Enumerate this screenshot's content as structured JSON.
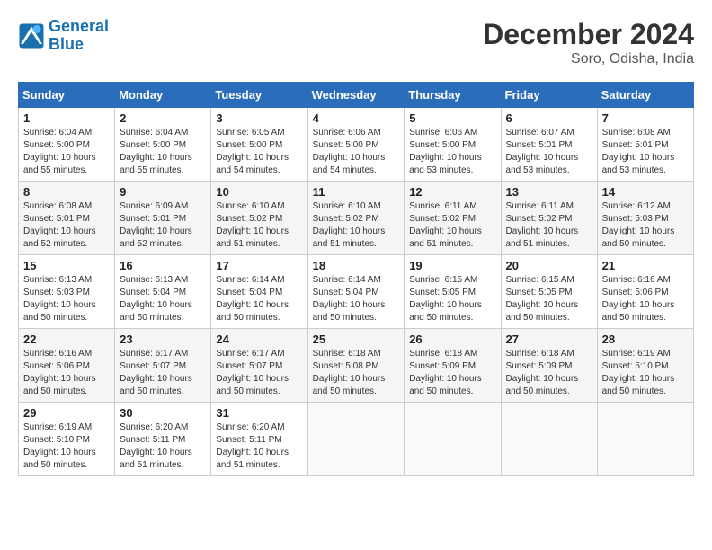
{
  "logo": {
    "line1": "General",
    "line2": "Blue"
  },
  "title": "December 2024",
  "subtitle": "Soro, Odisha, India",
  "weekdays": [
    "Sunday",
    "Monday",
    "Tuesday",
    "Wednesday",
    "Thursday",
    "Friday",
    "Saturday"
  ],
  "weeks": [
    [
      {
        "day": "1",
        "sunrise": "6:04 AM",
        "sunset": "5:00 PM",
        "daylight": "10 hours and 55 minutes."
      },
      {
        "day": "2",
        "sunrise": "6:04 AM",
        "sunset": "5:00 PM",
        "daylight": "10 hours and 55 minutes."
      },
      {
        "day": "3",
        "sunrise": "6:05 AM",
        "sunset": "5:00 PM",
        "daylight": "10 hours and 54 minutes."
      },
      {
        "day": "4",
        "sunrise": "6:06 AM",
        "sunset": "5:00 PM",
        "daylight": "10 hours and 54 minutes."
      },
      {
        "day": "5",
        "sunrise": "6:06 AM",
        "sunset": "5:00 PM",
        "daylight": "10 hours and 53 minutes."
      },
      {
        "day": "6",
        "sunrise": "6:07 AM",
        "sunset": "5:01 PM",
        "daylight": "10 hours and 53 minutes."
      },
      {
        "day": "7",
        "sunrise": "6:08 AM",
        "sunset": "5:01 PM",
        "daylight": "10 hours and 53 minutes."
      }
    ],
    [
      {
        "day": "8",
        "sunrise": "6:08 AM",
        "sunset": "5:01 PM",
        "daylight": "10 hours and 52 minutes."
      },
      {
        "day": "9",
        "sunrise": "6:09 AM",
        "sunset": "5:01 PM",
        "daylight": "10 hours and 52 minutes."
      },
      {
        "day": "10",
        "sunrise": "6:10 AM",
        "sunset": "5:02 PM",
        "daylight": "10 hours and 51 minutes."
      },
      {
        "day": "11",
        "sunrise": "6:10 AM",
        "sunset": "5:02 PM",
        "daylight": "10 hours and 51 minutes."
      },
      {
        "day": "12",
        "sunrise": "6:11 AM",
        "sunset": "5:02 PM",
        "daylight": "10 hours and 51 minutes."
      },
      {
        "day": "13",
        "sunrise": "6:11 AM",
        "sunset": "5:02 PM",
        "daylight": "10 hours and 51 minutes."
      },
      {
        "day": "14",
        "sunrise": "6:12 AM",
        "sunset": "5:03 PM",
        "daylight": "10 hours and 50 minutes."
      }
    ],
    [
      {
        "day": "15",
        "sunrise": "6:13 AM",
        "sunset": "5:03 PM",
        "daylight": "10 hours and 50 minutes."
      },
      {
        "day": "16",
        "sunrise": "6:13 AM",
        "sunset": "5:04 PM",
        "daylight": "10 hours and 50 minutes."
      },
      {
        "day": "17",
        "sunrise": "6:14 AM",
        "sunset": "5:04 PM",
        "daylight": "10 hours and 50 minutes."
      },
      {
        "day": "18",
        "sunrise": "6:14 AM",
        "sunset": "5:04 PM",
        "daylight": "10 hours and 50 minutes."
      },
      {
        "day": "19",
        "sunrise": "6:15 AM",
        "sunset": "5:05 PM",
        "daylight": "10 hours and 50 minutes."
      },
      {
        "day": "20",
        "sunrise": "6:15 AM",
        "sunset": "5:05 PM",
        "daylight": "10 hours and 50 minutes."
      },
      {
        "day": "21",
        "sunrise": "6:16 AM",
        "sunset": "5:06 PM",
        "daylight": "10 hours and 50 minutes."
      }
    ],
    [
      {
        "day": "22",
        "sunrise": "6:16 AM",
        "sunset": "5:06 PM",
        "daylight": "10 hours and 50 minutes."
      },
      {
        "day": "23",
        "sunrise": "6:17 AM",
        "sunset": "5:07 PM",
        "daylight": "10 hours and 50 minutes."
      },
      {
        "day": "24",
        "sunrise": "6:17 AM",
        "sunset": "5:07 PM",
        "daylight": "10 hours and 50 minutes."
      },
      {
        "day": "25",
        "sunrise": "6:18 AM",
        "sunset": "5:08 PM",
        "daylight": "10 hours and 50 minutes."
      },
      {
        "day": "26",
        "sunrise": "6:18 AM",
        "sunset": "5:09 PM",
        "daylight": "10 hours and 50 minutes."
      },
      {
        "day": "27",
        "sunrise": "6:18 AM",
        "sunset": "5:09 PM",
        "daylight": "10 hours and 50 minutes."
      },
      {
        "day": "28",
        "sunrise": "6:19 AM",
        "sunset": "5:10 PM",
        "daylight": "10 hours and 50 minutes."
      }
    ],
    [
      {
        "day": "29",
        "sunrise": "6:19 AM",
        "sunset": "5:10 PM",
        "daylight": "10 hours and 50 minutes."
      },
      {
        "day": "30",
        "sunrise": "6:20 AM",
        "sunset": "5:11 PM",
        "daylight": "10 hours and 51 minutes."
      },
      {
        "day": "31",
        "sunrise": "6:20 AM",
        "sunset": "5:11 PM",
        "daylight": "10 hours and 51 minutes."
      },
      null,
      null,
      null,
      null
    ]
  ]
}
